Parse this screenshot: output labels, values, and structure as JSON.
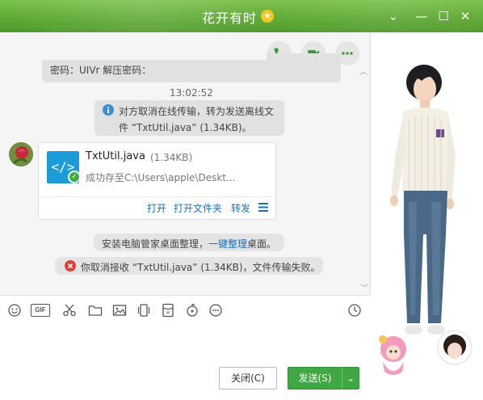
{
  "window": {
    "title": "花开有时",
    "vip_symbol": "★",
    "chevron_symbol": "⌄",
    "minimize_symbol": "—",
    "maximize_symbol": "☐",
    "close_symbol": "✕"
  },
  "messages": {
    "prev_snippet": "密码：UIVr 解压密码：",
    "timestamp": "13:02:52",
    "notice_line1": "对方取消在线传输，转为发送离线文",
    "notice_line2": "件 “TxtUtil.java” (1.34KB)。",
    "file": {
      "name": "TxtUtil.java",
      "size": "(1.34KB)",
      "status": "成功存至C:\\Users\\apple\\Deskt...",
      "icon_text": "</>",
      "actions": {
        "open": "打开",
        "open_folder": "打开文件夹",
        "forward": "转发"
      }
    },
    "tip_prefix": "安装电脑管家桌面整理，",
    "tip_link": "一键整理",
    "tip_suffix": "桌面。",
    "error_text": "你取消接收 “TxtUtil.java” (1.34KB)，文件传输失败。"
  },
  "toolbar": {
    "gif_label": "GIF"
  },
  "buttons": {
    "close": "关闭(C)",
    "send": "发送(S)",
    "send_arrow": "⌄"
  },
  "colors": {
    "title_green": "#5faa35",
    "send_green": "#3fa842",
    "link_blue": "#1a6fc4",
    "error_red": "#e0403a",
    "file_blue": "#1b9cd9"
  }
}
